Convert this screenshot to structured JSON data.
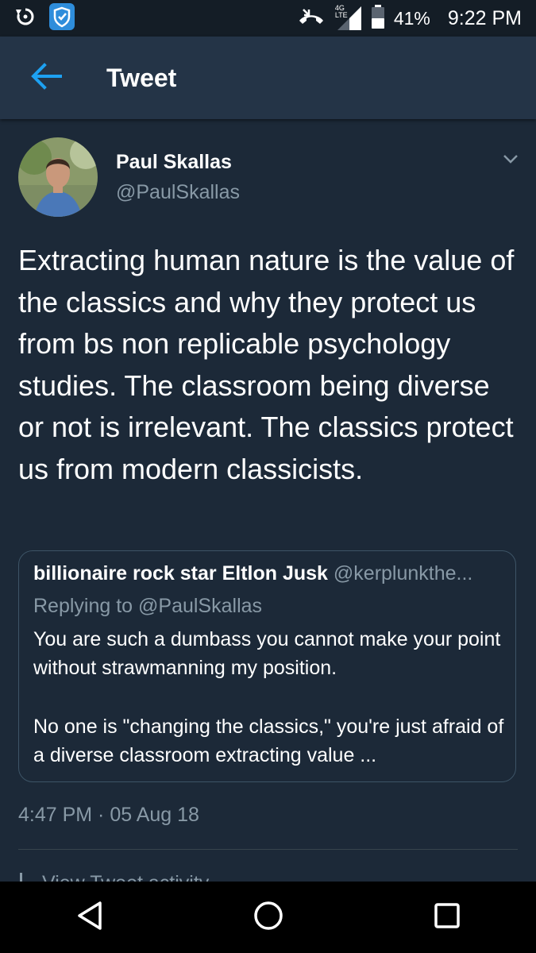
{
  "status_bar": {
    "network_label": "4G LTE",
    "battery_percent": "41%",
    "time": "9:22 PM",
    "icons": [
      "sync-icon",
      "shield-app-icon",
      "call-icon",
      "signal-icon",
      "battery-icon"
    ]
  },
  "app_bar": {
    "title": "Tweet",
    "back_icon": "arrow-left-icon",
    "accent_color": "#1da1f2"
  },
  "tweet": {
    "author_name": "Paul Skallas",
    "author_handle": "@PaulSkallas",
    "text": "Extracting human nature is the value of the classics and why they protect us from bs non replicable psychology studies. The classroom being diverse or not is irrelevant. The classics protect us from modern classicists.",
    "timestamp": "4:47 PM · 05 Aug 18",
    "activity_label": "View Tweet activity",
    "quoted": {
      "author_name": "billionaire rock star Eltlon Jusk",
      "author_handle": "@kerplunkthe...",
      "reply_label": "Replying to @PaulSkallas",
      "paragraph_1": "You are such a dumbass you cannot make your point without strawmanning my position.",
      "paragraph_2": "No one is \"changing the classics,\" you're just afraid of a diverse classroom extracting value ..."
    }
  },
  "nav_bar": {
    "icons": [
      "back-triangle-icon",
      "home-circle-icon",
      "recents-square-icon"
    ]
  },
  "colors": {
    "background": "#1c2938",
    "app_bar": "#243447",
    "status_bar": "#141d26",
    "secondary_text": "#8899a6",
    "border": "#3d5466"
  }
}
